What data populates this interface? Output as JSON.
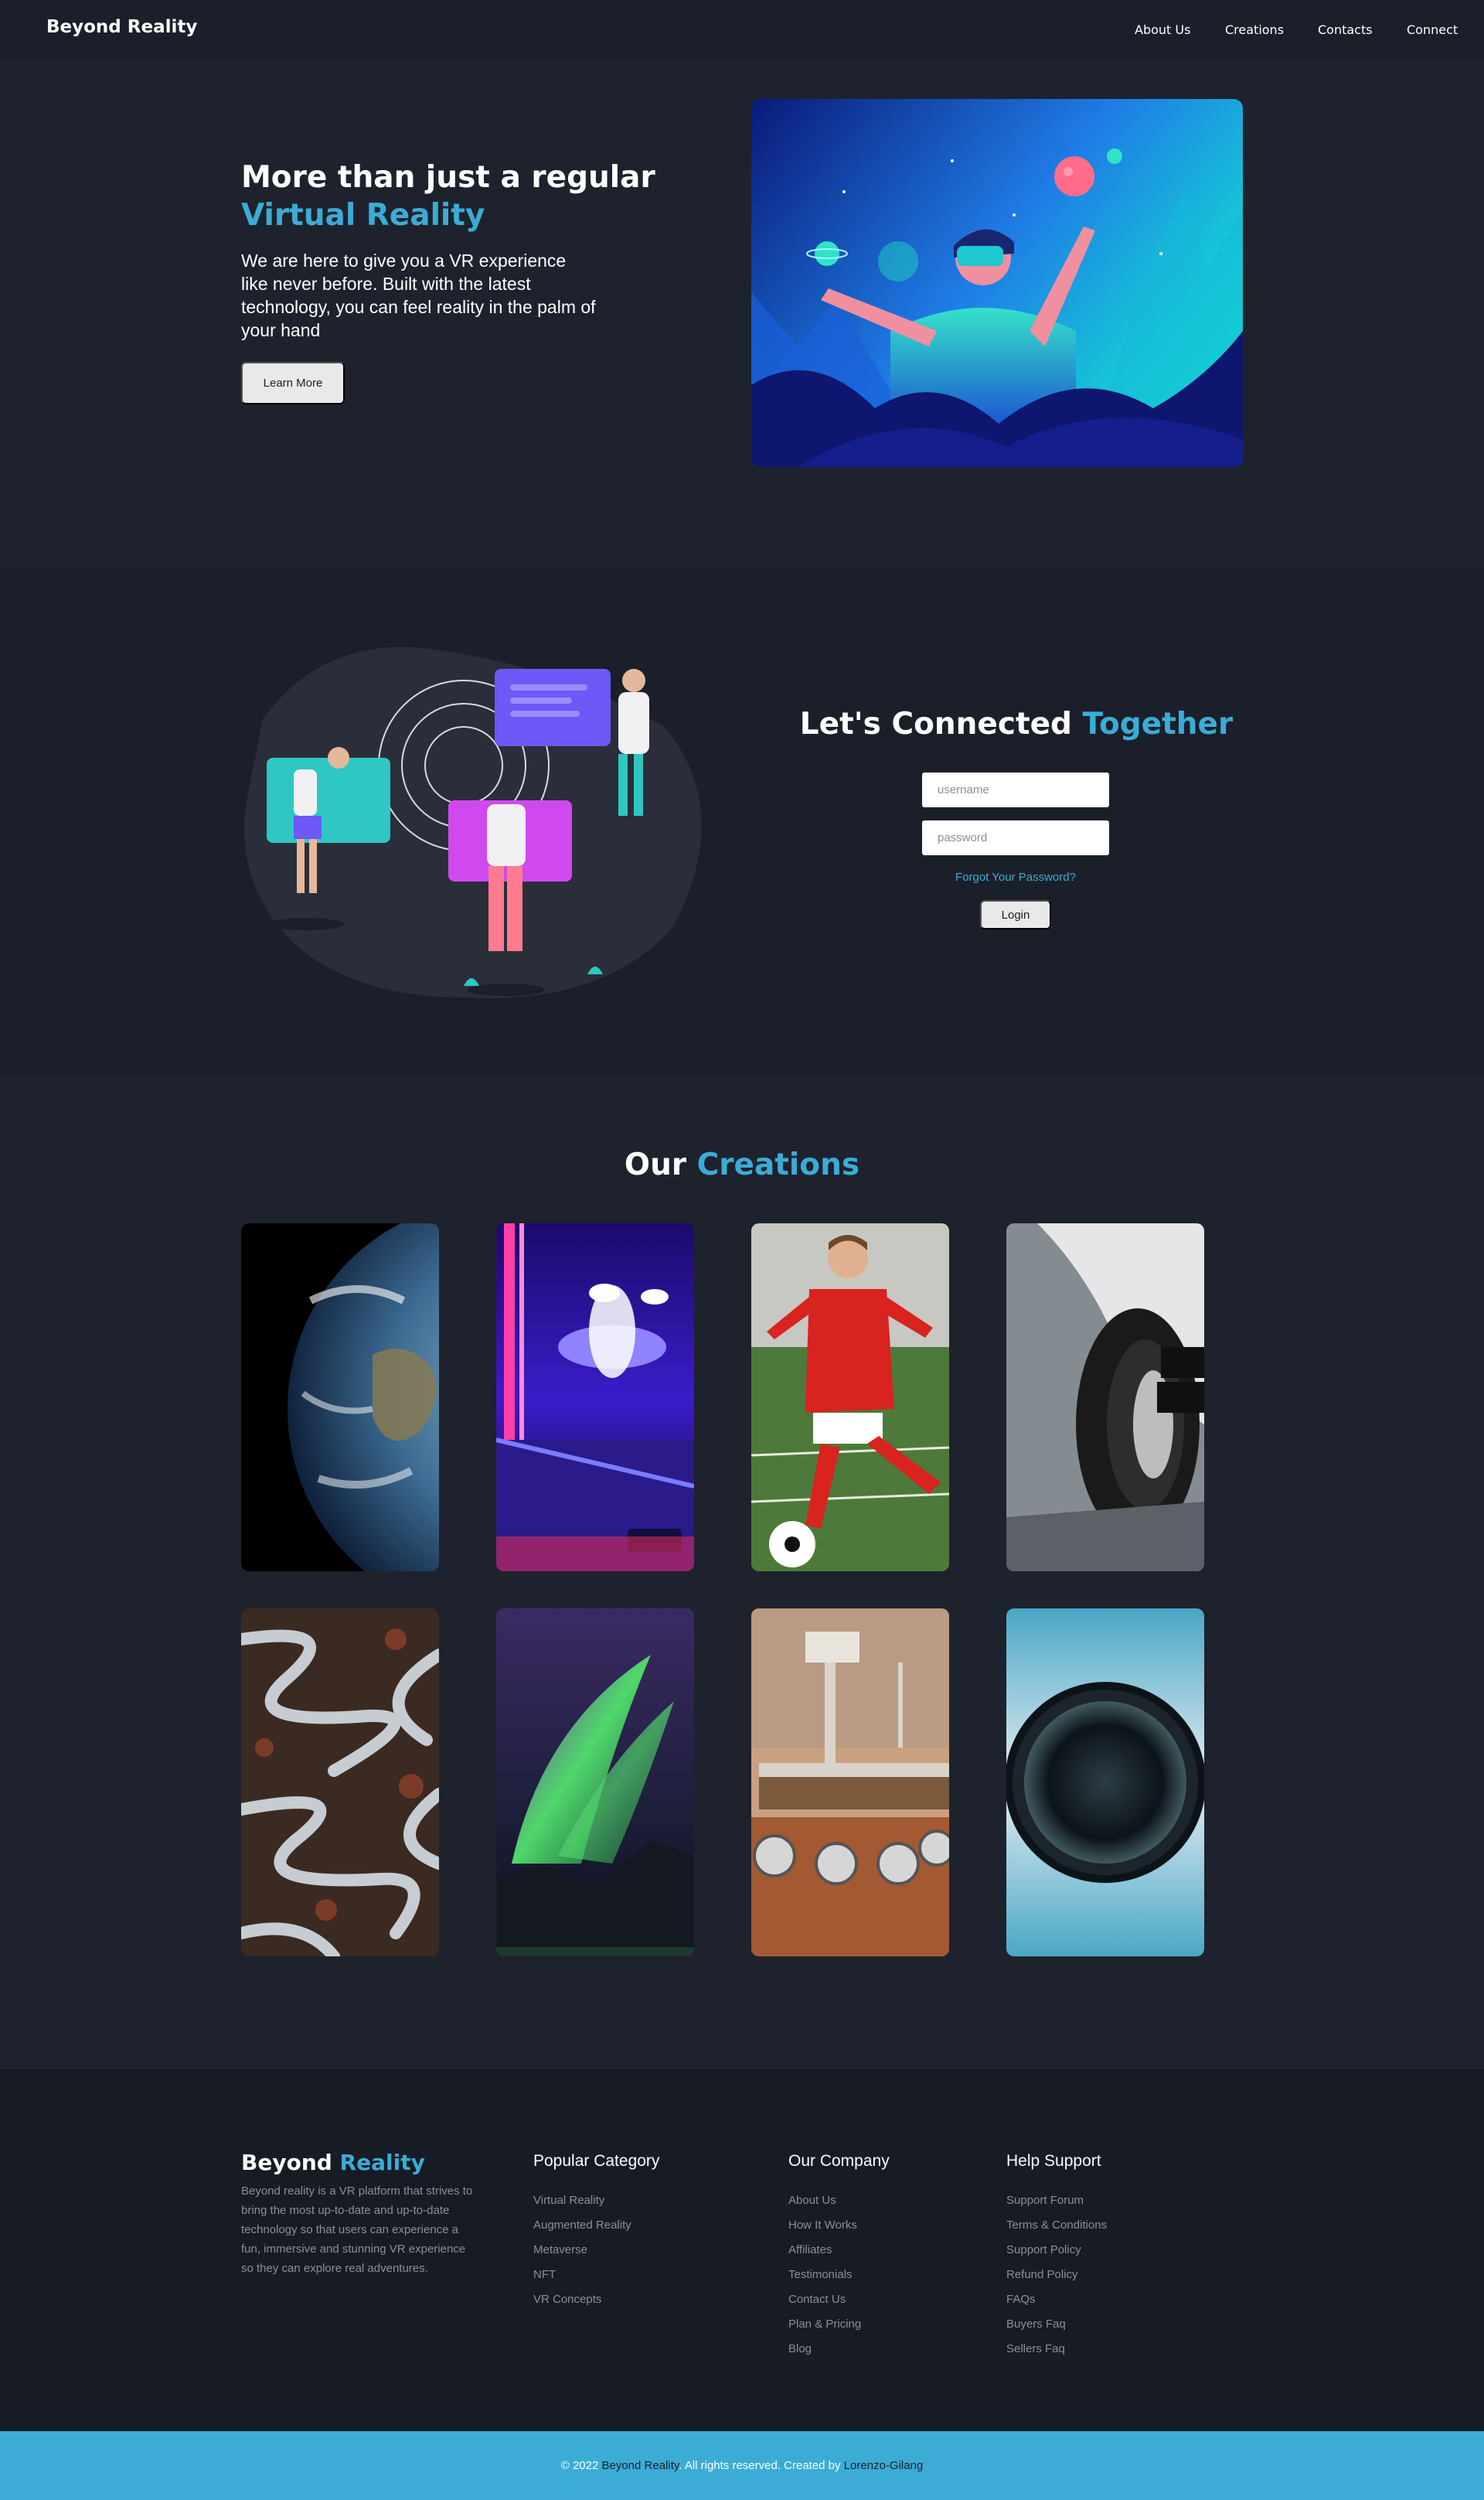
{
  "nav": {
    "brand": "Beyond Reality",
    "links": [
      "About Us",
      "Creations",
      "Contacts",
      "Connect"
    ]
  },
  "hero": {
    "title_main": "More than just a regular ",
    "title_accent": "Virtual Reality",
    "description": "We are here to give you a VR experience like never before. Built with the latest technology, you can feel reality in the palm of your hand",
    "button": "Learn More",
    "image_icon": "vr-person-illustration"
  },
  "connect": {
    "title_main": "Let's Connected ",
    "title_accent": "Together",
    "username_placeholder": "username",
    "password_placeholder": "password",
    "forgot": "Forgot Your Password?",
    "login": "Login",
    "image_icon": "chat-bubbles-illustration"
  },
  "creations": {
    "title_main": "Our ",
    "title_accent": "Creations",
    "images": [
      "earth-photo",
      "arcade-photo",
      "soccer-player-photo",
      "race-car-photo",
      "winding-road-photo",
      "aurora-photo",
      "mars-rover-photo",
      "tiny-planet-photo"
    ]
  },
  "footer": {
    "brand_main": "Beyond ",
    "brand_accent": "Reality",
    "description": "Beyond reality is a VR platform that strives to bring the most up-to-date and up-to-date technology so that users can experience a fun, immersive and stunning VR experience so they can explore real adventures.",
    "columns": [
      {
        "title": "Popular Category",
        "items": [
          "Virtual Reality",
          "Augmented Reality",
          "Metaverse",
          "NFT",
          "VR Concepts"
        ]
      },
      {
        "title": "Our Company",
        "items": [
          "About Us",
          "How It Works",
          "Affiliates",
          "Testimonials",
          "Contact Us",
          "Plan & Pricing",
          "Blog"
        ]
      },
      {
        "title": "Help Support",
        "items": [
          "Support Forum",
          "Terms & Conditions",
          "Support Policy",
          "Refund Policy",
          "FAQs",
          "Buyers Faq",
          "Sellers Faq"
        ]
      }
    ],
    "copyright_prefix": "© 2022 ",
    "copyright_brand": "Beyond Reality",
    "copyright_middle": ". All rights reserved. Created by ",
    "copyright_author": "Lorenzo-Gilang"
  },
  "colors": {
    "accent": "#3bacd6",
    "background": "#1e222d",
    "footer_bar": "#3bacd6"
  }
}
